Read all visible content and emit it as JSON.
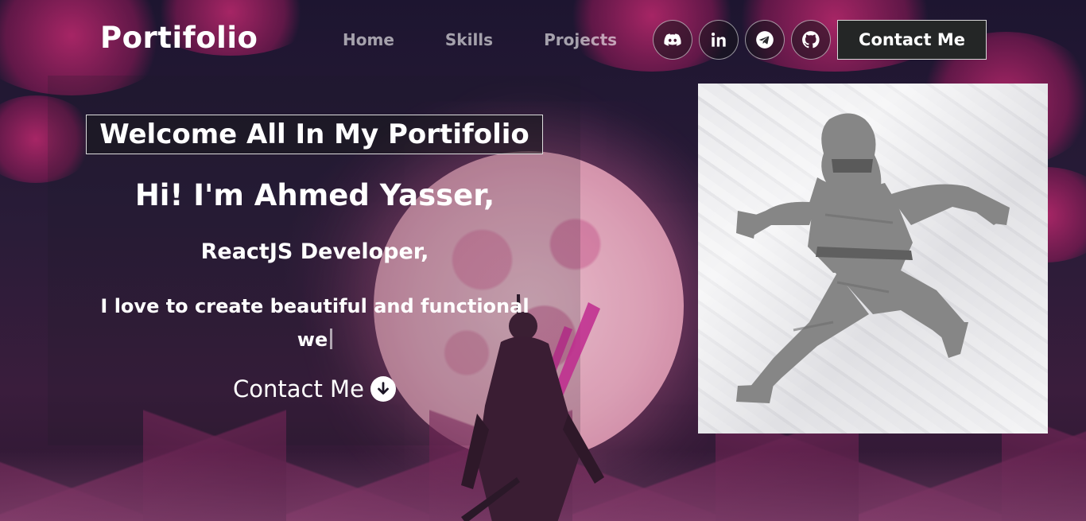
{
  "navbar": {
    "brand": "Portifolio",
    "links": [
      {
        "label": "Home"
      },
      {
        "label": "Skills"
      },
      {
        "label": "Projects"
      }
    ],
    "social": [
      {
        "icon": "discord-icon"
      },
      {
        "icon": "linkedin-icon"
      },
      {
        "icon": "telegram-icon"
      },
      {
        "icon": "github-icon"
      }
    ],
    "contact_label": "Contact Me"
  },
  "hero": {
    "welcome": "Welcome All In My Portifolio",
    "greeting": "Hi! I'm Ahmed Yasser,",
    "role": "ReactJS Developer,",
    "tagline_line1": "I love to create beautiful and functional",
    "tagline_line2": "we",
    "contact_label": "Contact Me",
    "contact_icon": "arrow-down-circle-icon",
    "image_icon": "ninja-illustration"
  },
  "colors": {
    "accent_pink": "#b8286e",
    "button_bg": "#242626"
  }
}
